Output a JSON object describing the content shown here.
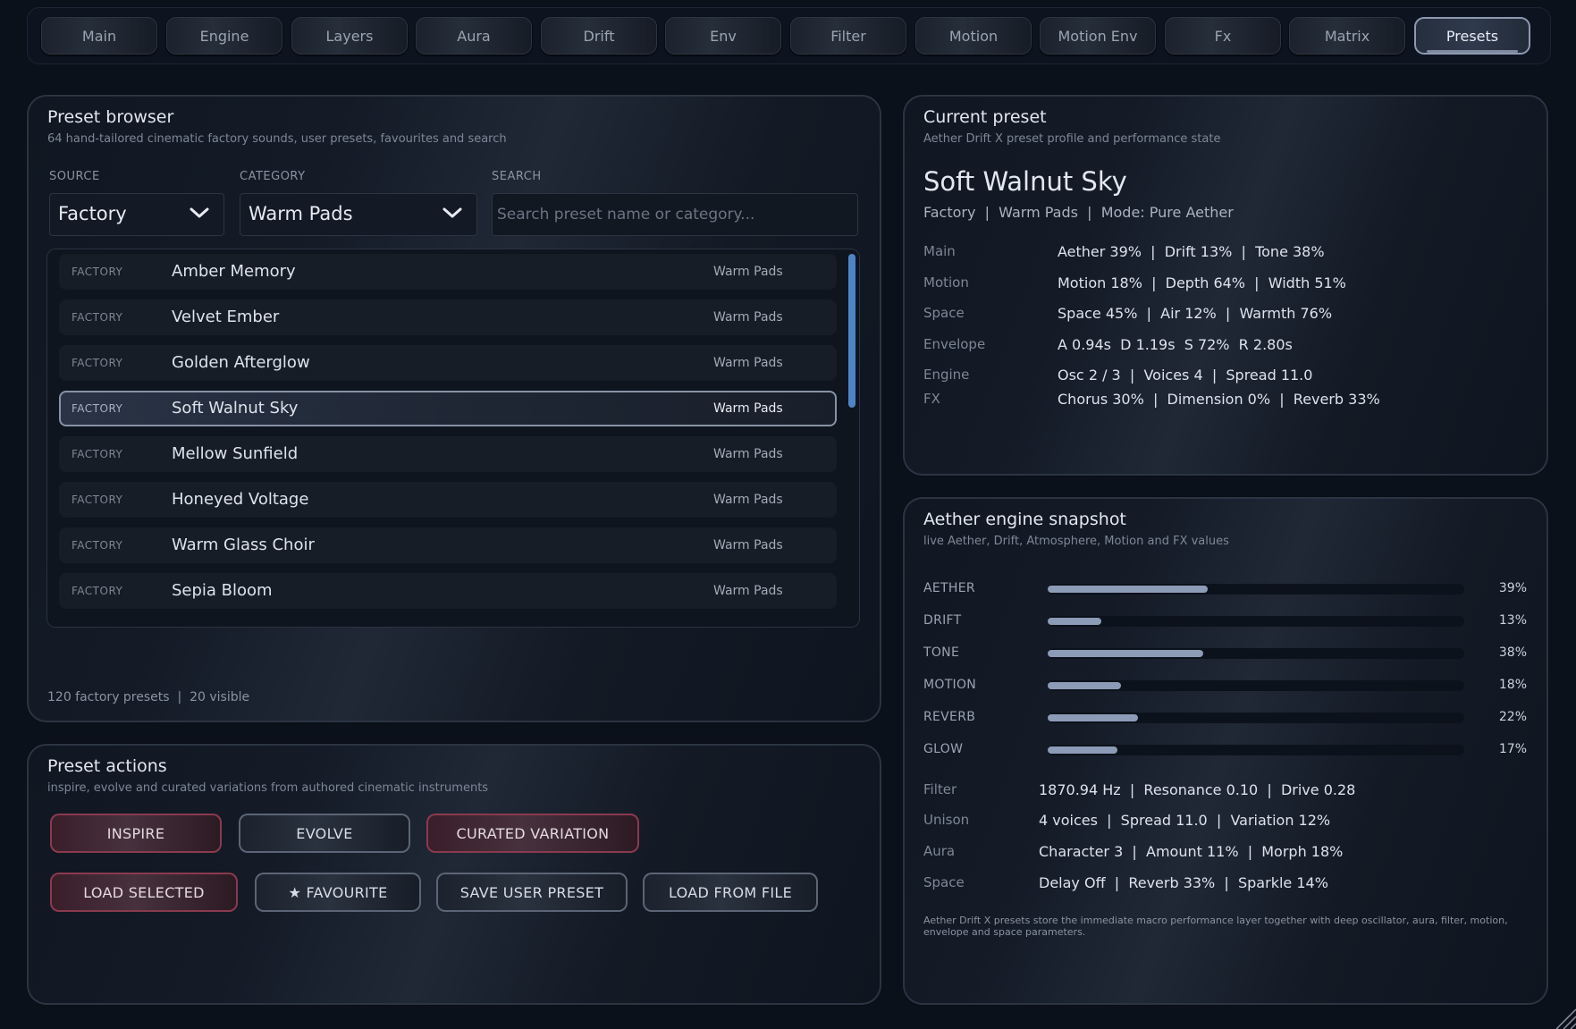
{
  "tabs": [
    {
      "label": "Main"
    },
    {
      "label": "Engine"
    },
    {
      "label": "Layers"
    },
    {
      "label": "Aura"
    },
    {
      "label": "Drift"
    },
    {
      "label": "Env"
    },
    {
      "label": "Filter"
    },
    {
      "label": "Motion"
    },
    {
      "label": "Motion Env"
    },
    {
      "label": "Fx"
    },
    {
      "label": "Matrix"
    },
    {
      "label": "Presets"
    }
  ],
  "browser": {
    "title": "Preset browser",
    "subtitle": "64 hand-tailored cinematic factory sounds, user presets, favourites and search",
    "source_label": "SOURCE",
    "source_value": "Factory",
    "category_label": "CATEGORY",
    "category_value": "Warm Pads",
    "search_label": "SEARCH",
    "search_placeholder": "Search preset name or category...",
    "search_value": "",
    "rows": [
      {
        "source": "FACTORY",
        "name": "Amber Memory",
        "category": "Warm Pads"
      },
      {
        "source": "FACTORY",
        "name": "Velvet Ember",
        "category": "Warm Pads"
      },
      {
        "source": "FACTORY",
        "name": "Golden Afterglow",
        "category": "Warm Pads"
      },
      {
        "source": "FACTORY",
        "name": "Soft Walnut Sky",
        "category": "Warm Pads"
      },
      {
        "source": "FACTORY",
        "name": "Mellow Sunfield",
        "category": "Warm Pads"
      },
      {
        "source": "FACTORY",
        "name": "Honeyed Voltage",
        "category": "Warm Pads"
      },
      {
        "source": "FACTORY",
        "name": "Warm Glass Choir",
        "category": "Warm Pads"
      },
      {
        "source": "FACTORY",
        "name": "Sepia Bloom",
        "category": "Warm Pads"
      }
    ],
    "count_text": "120 factory presets  |  20 visible"
  },
  "actions": {
    "title": "Preset actions",
    "subtitle": "inspire, evolve and curated variations from authored cinematic instruments",
    "inspire": "INSPIRE",
    "evolve": "EVOLVE",
    "curated": "CURATED VARIATION",
    "load_selected": "LOAD SELECTED",
    "favourite": "★  FAVOURITE",
    "save_user": "SAVE USER PRESET",
    "load_file": "LOAD FROM FILE"
  },
  "current": {
    "title": "Current preset",
    "subtitle": "Aether Drift X preset profile and performance state",
    "name": "Soft Walnut Sky",
    "meta": "Factory  |  Warm Pads  |  Mode: Pure Aether",
    "params": [
      {
        "key": "Main",
        "value": "Aether 39%  |  Drift 13%  |  Tone 38%"
      },
      {
        "key": "Motion",
        "value": "Motion 18%  |  Depth 64%  |  Width 51%"
      },
      {
        "key": "Space",
        "value": "Space 45%  |  Air 12%  |  Warmth 76%"
      },
      {
        "key": "Envelope",
        "value": "A 0.94s  D 1.19s  S 72%  R 2.80s"
      },
      {
        "key": "Engine",
        "value": "Osc 2 / 3  |  Voices 4  |  Spread 11.0"
      },
      {
        "key": "FX",
        "value": "Chorus 30%  |  Dimension 0%  |  Reverb 33%"
      }
    ]
  },
  "snapshot": {
    "title": "Aether engine snapshot",
    "subtitle": "live Aether, Drift, Atmosphere, Motion and FX values",
    "bars": [
      {
        "label": "AETHER",
        "value": 39,
        "pct": "39%"
      },
      {
        "label": "DRIFT",
        "value": 13,
        "pct": "13%"
      },
      {
        "label": "TONE",
        "value": 38,
        "pct": "38%"
      },
      {
        "label": "MOTION",
        "value": 18,
        "pct": "18%"
      },
      {
        "label": "REVERB",
        "value": 22,
        "pct": "22%"
      },
      {
        "label": "GLOW",
        "value": 17,
        "pct": "17%"
      }
    ],
    "params": [
      {
        "key": "Filter",
        "value": "1870.94 Hz  |  Resonance 0.10  |  Drive 0.28"
      },
      {
        "key": "Unison",
        "value": "4 voices  |  Spread 11.0  |  Variation 12%"
      },
      {
        "key": "Aura",
        "value": "Character 3  |  Amount 11%  |  Morph 18%"
      },
      {
        "key": "Space",
        "value": "Delay Off  |  Reverb 33%  |  Sparkle 14%"
      }
    ],
    "footnote": "Aether Drift X presets store the immediate macro performance layer together with deep oscillator, aura, filter, motion, envelope and space parameters."
  },
  "colors": {
    "accent": "#8c9bb6",
    "scroll": "#4d84c4",
    "red_border": "#8a3a4e"
  }
}
